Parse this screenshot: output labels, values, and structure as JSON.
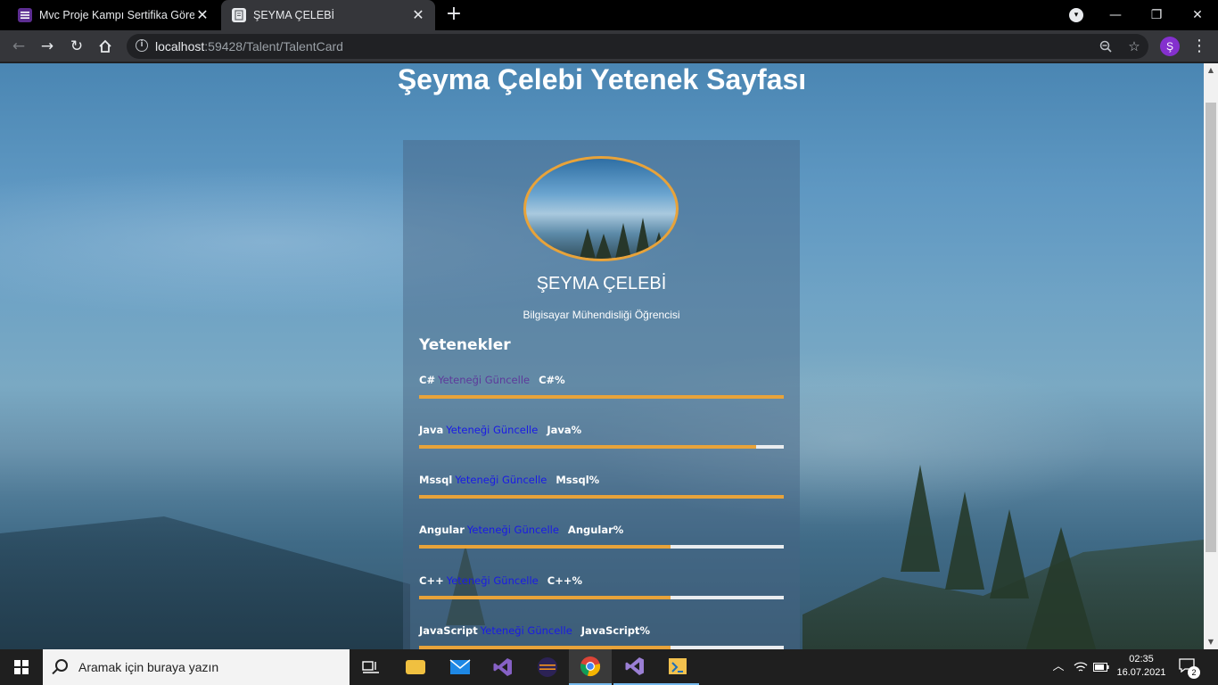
{
  "browser": {
    "tabs": [
      {
        "title": "Mvc Proje Kampı Sertifika Görev",
        "close": "✕",
        "icon": "list-icon"
      },
      {
        "title": "ŞEYMA ÇELEBİ",
        "close": "✕",
        "icon": "document-icon"
      }
    ],
    "new_tab": "+",
    "window_controls": {
      "minimize": "—",
      "maximize": "❐",
      "close": "✕"
    },
    "url_host": "localhost",
    "url_rest": ":59428/Talent/TalentCard",
    "profile_initial": "Ş"
  },
  "page": {
    "title": "Şeyma Çelebi Yetenek Sayfası",
    "card": {
      "name": "ŞEYMA ÇELEBİ",
      "subtitle": "Bilgisayar Mühendisliği Öğrencisi",
      "skills_heading": "Yetenekler",
      "skills": [
        {
          "name": "C#",
          "link": "Yeteneği Güncelle",
          "percent_label": "C#%",
          "level": 1.0,
          "visited": true
        },
        {
          "name": "Java",
          "link": "Yeteneği Güncelle",
          "percent_label": "Java%",
          "level": 0.925,
          "visited": false
        },
        {
          "name": "Mssql",
          "link": "Yeteneği Güncelle",
          "percent_label": "Mssql%",
          "level": 1.0,
          "visited": false
        },
        {
          "name": "Angular",
          "link": "Yeteneği Güncelle",
          "percent_label": "Angular%",
          "level": 0.69,
          "visited": false
        },
        {
          "name": "C++",
          "link": "Yeteneği Güncelle",
          "percent_label": "C++%",
          "level": 0.69,
          "visited": false
        },
        {
          "name": "JavaScript",
          "link": "Yeteneği Güncelle",
          "percent_label": "JavaScript%",
          "level": 0.69,
          "visited": false
        }
      ]
    }
  },
  "taskbar": {
    "search_placeholder": "Aramak için buraya yazın",
    "time": "02:35",
    "date": "16.07.2021",
    "notification_count": "2"
  },
  "colors": {
    "accent_orange": "#e8a33a",
    "link_blue": "#1a1ae6",
    "link_visited": "#5d3a9b"
  }
}
